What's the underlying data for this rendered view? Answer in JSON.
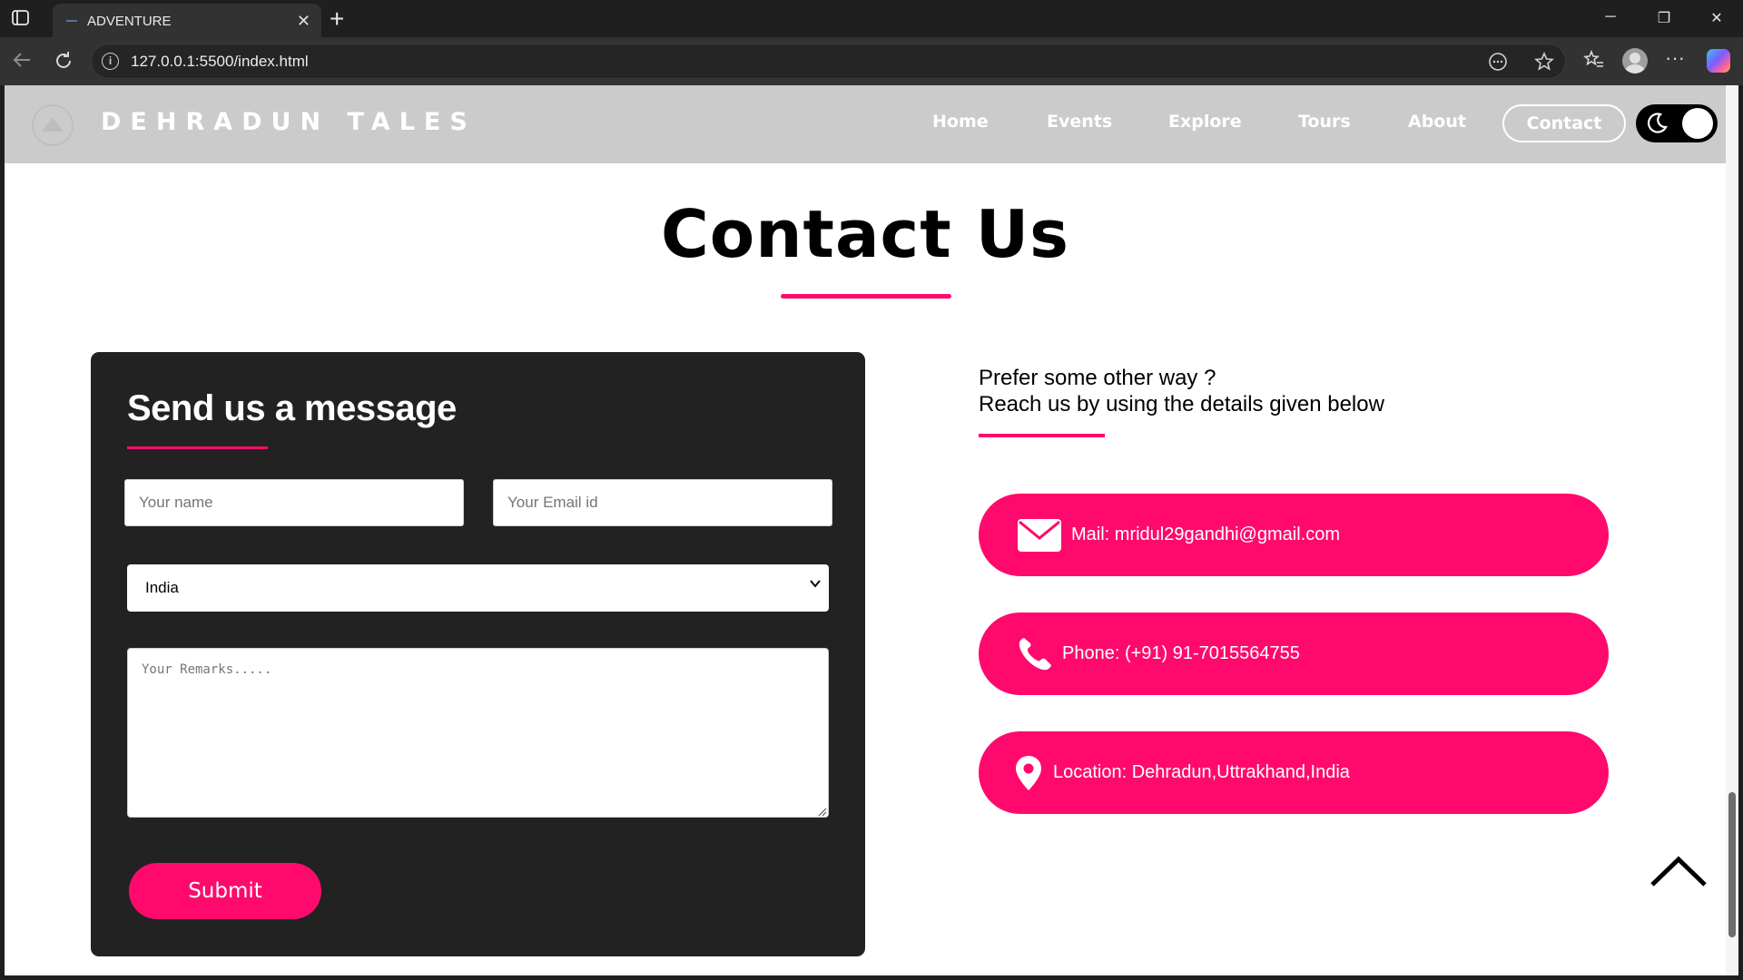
{
  "browser": {
    "tab_title": "ADVENTURE",
    "url": "127.0.0.1:5500/index.html"
  },
  "site": {
    "brand": "DEHRADUN TALES",
    "nav": [
      {
        "label": "Home"
      },
      {
        "label": "Events"
      },
      {
        "label": "Explore"
      },
      {
        "label": "Tours"
      },
      {
        "label": "About"
      }
    ],
    "nav_contact": "Contact"
  },
  "page": {
    "title": "Contact Us"
  },
  "form": {
    "heading": "Send us a message",
    "name_placeholder": "Your name",
    "email_placeholder": "Your Email id",
    "country_value": "India",
    "remarks_placeholder": "Your Remarks.....",
    "submit_label": "Submit"
  },
  "info": {
    "intro_line1": "Prefer some other way ?",
    "intro_line2": "Reach us by using the details given below",
    "mail": "Mail: mridul29gandhi@gmail.com",
    "phone": "Phone: (+91) 91-7015564755",
    "location": "Location: Dehradun,Uttrakhand,India"
  },
  "colors": {
    "accent": "#ff0a6c",
    "header_bg": "#cbcbcb",
    "panel_bg": "#222222"
  }
}
